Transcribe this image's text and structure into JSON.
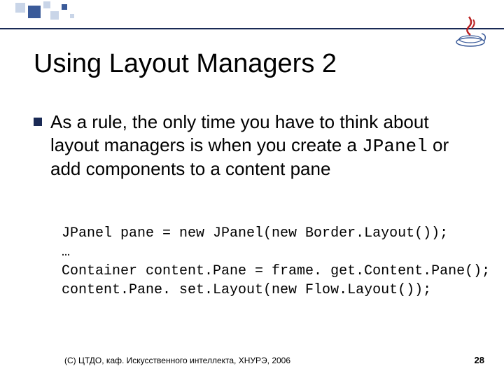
{
  "slide": {
    "title": "Using Layout Managers 2",
    "bullet": {
      "text_before": "As a rule, the only time you have to think about layout managers is when you create a ",
      "code_inline": "JPanel",
      "text_after": " or add components to a content pane"
    },
    "code": "JPanel pane = new JPanel(new Border.Layout());\n…\nContainer content.Pane = frame. get.Content.Pane();\ncontent.Pane. set.Layout(new Flow.Layout());",
    "footer": "(С) ЦТДО, каф. Искусственного интеллекта, ХНУРЭ, 2006",
    "page_number": "28"
  }
}
